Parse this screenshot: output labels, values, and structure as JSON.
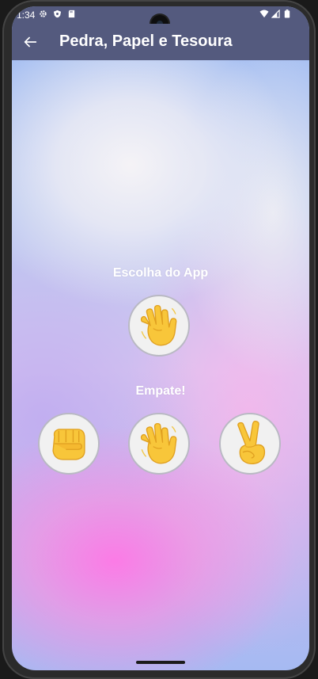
{
  "status_bar": {
    "time": "1:34"
  },
  "app_bar": {
    "title": "Pedra, Papel e Tesoura"
  },
  "app_choice": {
    "label": "Escolha do App",
    "choice_icon": "raised-hand-icon"
  },
  "result": {
    "text": "Empate!"
  },
  "options": [
    {
      "name": "pedra",
      "icon": "fist-icon"
    },
    {
      "name": "papel",
      "icon": "raised-hand-icon"
    },
    {
      "name": "tesoura",
      "icon": "victory-hand-icon"
    }
  ],
  "colors": {
    "app_bar": "#545a7e",
    "label_text": "#ffffff",
    "option_bg": "#f1f1f1",
    "option_border": "#b9b9c3",
    "emoji_skin": "#f8c63a"
  }
}
